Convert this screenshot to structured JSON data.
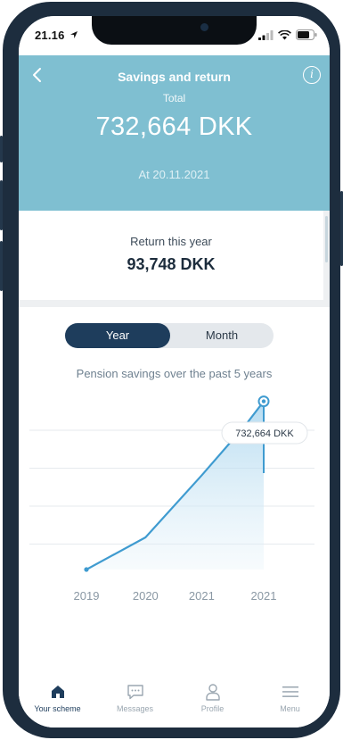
{
  "status_bar": {
    "time": "21.16"
  },
  "header": {
    "title": "Savings and return",
    "total_label": "Total",
    "total_value": "732,664 DKK",
    "date": "At 20.11.2021"
  },
  "return_card": {
    "label": "Return this year",
    "value": "93,748 DKK"
  },
  "toggle": {
    "year_label": "Year",
    "month_label": "Month",
    "selected": "Year"
  },
  "chart": {
    "tooltip": "732,664 DKK"
  },
  "chart_data": {
    "type": "area",
    "title": "Pension savings over the past 5 years",
    "categories": [
      "2019",
      "2020",
      "2021",
      "2021"
    ],
    "x": [
      0,
      1.0,
      1.95,
      2.7,
      3.0
    ],
    "series": [
      {
        "values": [
          0,
          140000,
          410000,
          632000,
          732664
        ]
      }
    ],
    "ylim": [
      0,
      770000
    ],
    "grid": true,
    "tooltip_value": 732664,
    "accent": "#3f9bd0"
  },
  "tabs": [
    {
      "label": "Your scheme",
      "icon": "home-icon",
      "active": true
    },
    {
      "label": "Messages",
      "icon": "chat-icon",
      "active": false
    },
    {
      "label": "Profile",
      "icon": "person-icon",
      "active": false
    },
    {
      "label": "Menu",
      "icon": "menu-icon",
      "active": false
    }
  ],
  "colors": {
    "header_bg": "#7fbfd1",
    "brand_dark": "#1e3d5c",
    "line": "#3f9bd0"
  }
}
